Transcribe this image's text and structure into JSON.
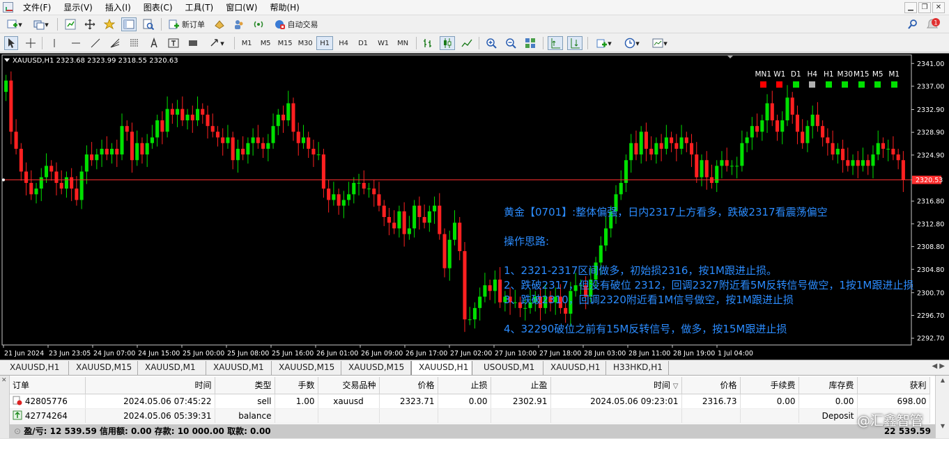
{
  "menu": [
    "文件(F)",
    "显示(V)",
    "插入(I)",
    "图表(C)",
    "工具(T)",
    "窗口(W)",
    "帮助(H)"
  ],
  "toolbar1": {
    "new_order": "新订单",
    "auto_trade": "自动交易"
  },
  "toolbar2": {
    "timeframes": [
      "M1",
      "M5",
      "M15",
      "M30",
      "H1",
      "H4",
      "D1",
      "W1",
      "MN"
    ],
    "active_timeframe": "H1"
  },
  "chart": {
    "title": "XAUUSD,H1  2323.68 2323.99 2318.55 2320.63",
    "current_price_label": "2320.53",
    "indicator_labels": [
      "MN1",
      "W1",
      "D1",
      "H4",
      "H1",
      "M30",
      "M15",
      "M5",
      "M1"
    ],
    "indicator_colors": [
      "#ff0000",
      "#ff0000",
      "#00e000",
      "#b0b0b0",
      "#00e000",
      "#00e000",
      "#00e000",
      "#00e000",
      "#00e000"
    ],
    "annotations": [
      "黄金【0701】:整体偏强，日内2317上方看多，跌破2317看震荡偏空",
      "",
      "操作思路:",
      "",
      "1、2321-2317区间做多，初始损2316，按1M跟进止损。",
      "2、跌破2317，但没有破位 2312，回调2327附近看5M反转信号做空，1按1M跟进止损",
      "3、跌破2310，回调2320附近看1M信号做空，按1M跟进止损",
      "",
      "4、32290破位之前有15M反转信号，做多，按15M跟进止损"
    ],
    "colors": {
      "bull": "#00e000",
      "bear": "#ff2020",
      "bg": "#000000",
      "price_line": "#ff3030"
    }
  },
  "chart_data": {
    "type": "candlestick",
    "symbol": "XAUUSD",
    "timeframe": "H1",
    "y_ticks": [
      2341.0,
      2337.0,
      2332.9,
      2328.9,
      2324.9,
      2320.53,
      2316.8,
      2312.8,
      2308.8,
      2304.8,
      2300.7,
      2296.7,
      2292.7
    ],
    "y_tick_labels": [
      "2341.00",
      "2337.00",
      "2332.90",
      "2328.90",
      "2324.90",
      "2320.53",
      "2316.80",
      "2312.80",
      "2308.80",
      "2304.80",
      "2300.70",
      "2296.70",
      "2292.70"
    ],
    "ylim": [
      2291.5,
      2342.5
    ],
    "x_labels": [
      "21 Jun 2024",
      "23 Jun 23:05",
      "24 Jun 07:00",
      "24 Jun 15:00",
      "25 Jun 00:00",
      "25 Jun 08:00",
      "25 Jun 16:00",
      "26 Jun 01:00",
      "26 Jun 09:00",
      "26 Jun 17:00",
      "27 Jun 02:00",
      "27 Jun 10:00",
      "27 Jun 18:00",
      "28 Jun 03:00",
      "28 Jun 11:00",
      "28 Jun 19:00",
      "1 Jul 04:00"
    ],
    "close": [
      2338,
      2329,
      2326,
      2322,
      2320,
      2318,
      2319,
      2321,
      2323,
      2322,
      2320,
      2319,
      2321,
      2319,
      2317,
      2322,
      2325,
      2324,
      2325,
      2326,
      2325,
      2326,
      2325,
      2330,
      2329,
      2324,
      2327,
      2325,
      2327,
      2328,
      2331,
      2329,
      2333,
      2332,
      2333,
      2331,
      2332,
      2331,
      2333,
      2332,
      2330,
      2329,
      2328,
      2327,
      2328,
      2324,
      2326,
      2325,
      2327,
      2328,
      2327,
      2326,
      2327,
      2330,
      2332,
      2331,
      2334,
      2329,
      2327,
      2328,
      2326,
      2325,
      2325,
      2319,
      2317,
      2318,
      2316,
      2317,
      2318,
      2320,
      2320,
      2319,
      2319,
      2318,
      2316,
      2314,
      2313,
      2312,
      2315,
      2311,
      2312,
      2316,
      2314,
      2313,
      2315,
      2316,
      2311,
      2305,
      2310,
      2313,
      2308,
      2296,
      2296,
      2298,
      2300,
      2302,
      2301,
      2303,
      2299,
      2300,
      2299,
      2299,
      2298,
      2298,
      2299,
      2300,
      2298,
      2300,
      2299,
      2300,
      2298,
      2297,
      2301,
      2302,
      2302,
      2300,
      2303,
      2306,
      2309,
      2312,
      2315,
      2318,
      2320,
      2324,
      2327,
      2325,
      2329,
      2326,
      2325,
      2327,
      2326,
      2328,
      2327,
      2326,
      2328,
      2327,
      2325,
      2321,
      2324,
      2321,
      2320,
      2323,
      2324,
      2323,
      2323,
      2323,
      2327,
      2328,
      2330,
      2329,
      2331,
      2334,
      2331,
      2329,
      2331,
      2335,
      2332,
      2329,
      2327,
      2330,
      2332,
      2330,
      2328,
      2327,
      2325,
      2326,
      2324,
      2323,
      2324,
      2323,
      2324,
      2323,
      2325,
      2327,
      2326,
      2326,
      2325,
      2324,
      2320.6
    ]
  },
  "chart_tabs": [
    "XAUUSD,H1",
    "XAUUSD,M15",
    "XAUUSD,M1",
    "XAUUSD,M1",
    "XAUUSD,M15",
    "XAUUSD,M15",
    "XAUUSD,H1",
    "USOUSD,M1",
    "XAUUSD,H1",
    "H33HKD,H1"
  ],
  "active_tab_index": 6,
  "terminal": {
    "headers": [
      "订单",
      "时间",
      "类型",
      "手数",
      "交易品种",
      "价格",
      "止损",
      "止盈",
      "时间",
      "价格",
      "手续费",
      "库存费",
      "获利"
    ],
    "sort_indicator": "▽",
    "rows": [
      [
        "42805776",
        "2024.05.06 07:45:22",
        "sell",
        "1.00",
        "xauusd",
        "2323.71",
        "0.00",
        "2302.91",
        "2024.05.06 09:23:01",
        "2316.73",
        "0.00",
        "0.00",
        "698.00"
      ],
      [
        "42774264",
        "2024.05.06 05:39:31",
        "balance",
        "",
        "",
        "",
        "",
        "",
        "",
        "",
        "",
        "Deposit",
        ""
      ]
    ],
    "summary_left": "盈/亏: 12 539.59  信用额: 0.00  存款: 10 000.00  取款: 0.00",
    "summary_right": "22 539.59"
  },
  "watermark": "@汇鑫智管"
}
